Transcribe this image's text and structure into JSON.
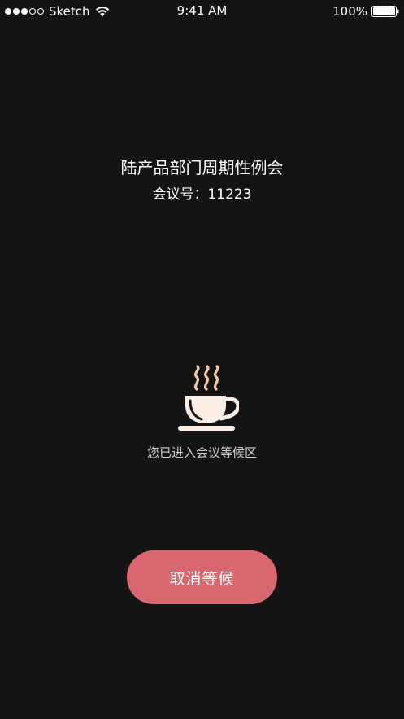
{
  "status_bar": {
    "carrier": "Sketch",
    "time": "9:41 AM",
    "battery_percent": "100%",
    "signal_bars_filled": 3,
    "signal_bars_total": 5
  },
  "meeting": {
    "title": "陆产品部门周期性例会",
    "id_label": "会议号：",
    "id_value": "11223"
  },
  "waiting": {
    "icon": "coffee-cup-icon",
    "message": "您已进入会议等候区"
  },
  "actions": {
    "cancel_label": "取消等候"
  },
  "colors": {
    "background": "#141414",
    "accent": "#d96770",
    "cup": "#fbeee6",
    "steam": "#f3c9a6"
  }
}
